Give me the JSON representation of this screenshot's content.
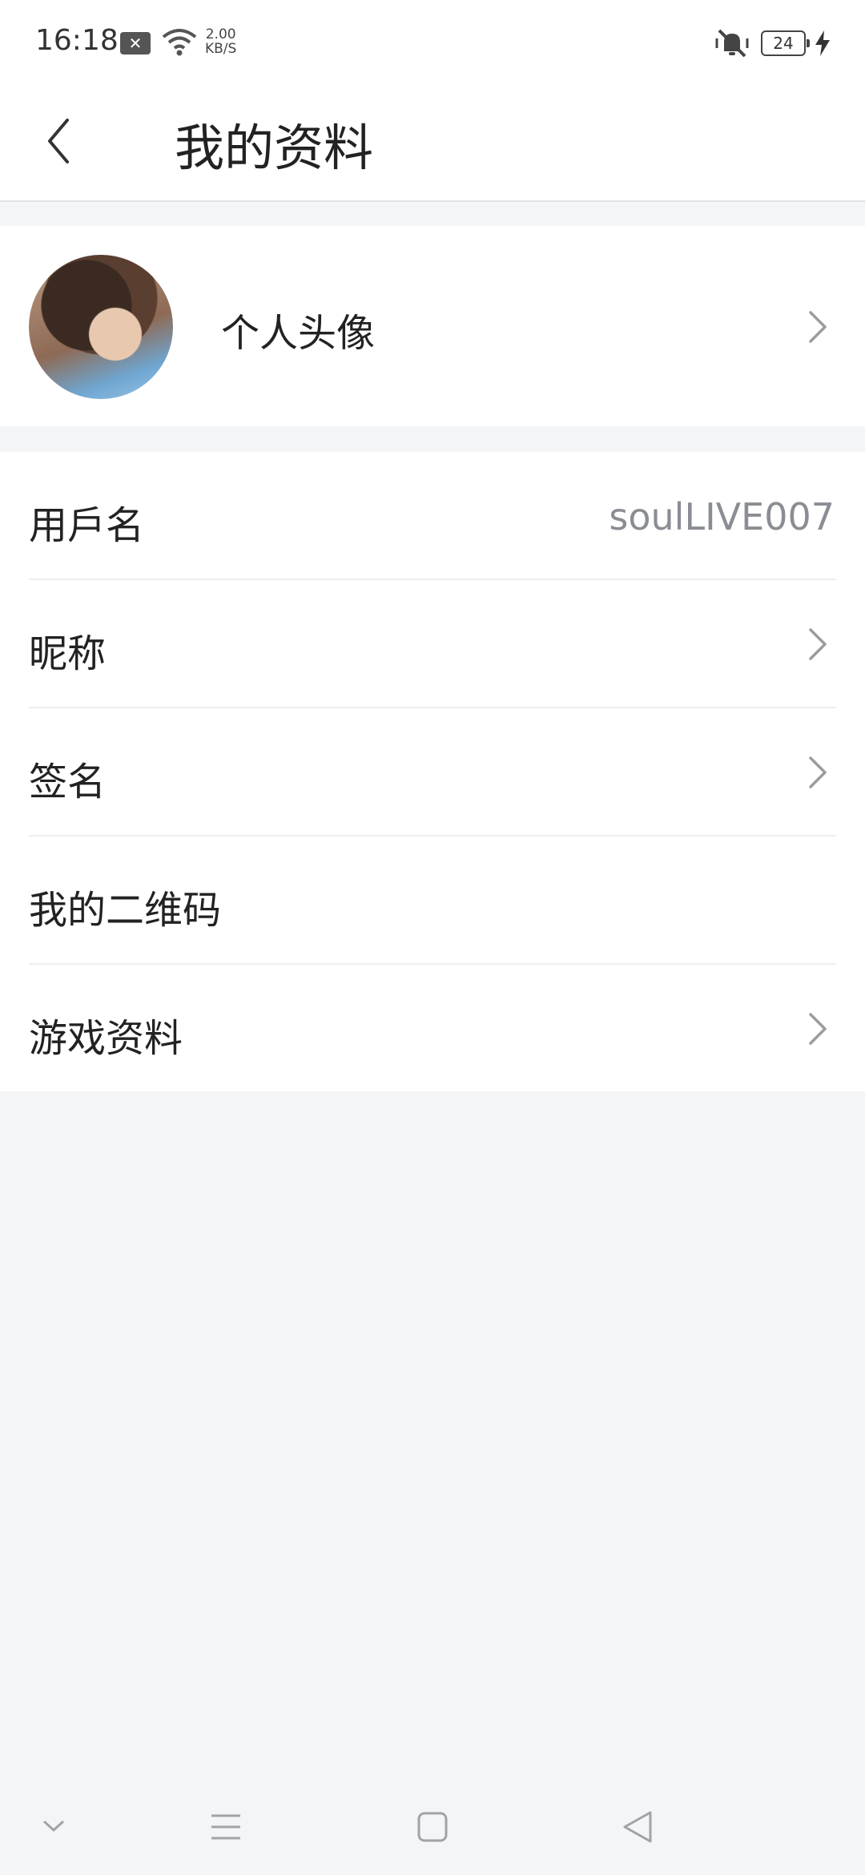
{
  "status_bar": {
    "time": "16:18",
    "net_speed_value": "2.00",
    "net_speed_unit": "KB/S",
    "battery": "24"
  },
  "header": {
    "title": "我的资料"
  },
  "avatar_row": {
    "label": "个人头像"
  },
  "list": {
    "username_label": "用戶名",
    "username_value": "soulLIVE007",
    "nickname_label": "昵称",
    "signature_label": "签名",
    "qrcode_label": "我的二维码",
    "game_profile_label": "游戏资料"
  },
  "colors": {
    "background": "#f4f5f7",
    "card": "#ffffff",
    "text": "#222222",
    "muted": "#8a8d93"
  },
  "icons": [
    "back-arrow-icon",
    "chevron-right-icon",
    "wifi-icon",
    "mute-icon",
    "charging-icon",
    "nav-down-icon",
    "nav-menu-icon",
    "nav-home-icon",
    "nav-back-icon"
  ]
}
